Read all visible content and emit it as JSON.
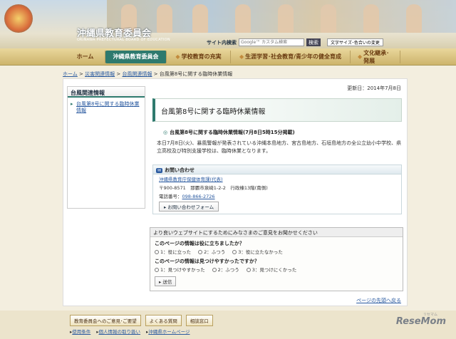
{
  "header": {
    "title": "沖縄県教育委員会",
    "subtitle": "OKINAWA PREFECTURAL BOARD OF EDUCATION",
    "search_label": "サイト内検索",
    "search_placeholder": "Google™ カスタム検索",
    "search_button": "検索",
    "style_button": "文字サイズ･色合いの変更"
  },
  "nav": {
    "items": [
      {
        "label": "ホーム"
      },
      {
        "label": "沖縄県教育委員会"
      },
      {
        "label": "学校教育の充実"
      },
      {
        "label": "生涯学習･社会教育/青少年の健全育成"
      },
      {
        "label": "文化継承･発展"
      }
    ]
  },
  "breadcrumb": {
    "home": "ホーム",
    "disaster": "災害関連情報",
    "typhoon": "台風関連情報",
    "current": "台風第8号に関する臨時休業情報",
    "sep": " > "
  },
  "sidebar": {
    "heading": "台風関連情報",
    "item": "台風第8号に関する臨時休業情報"
  },
  "main": {
    "updated": "更新日：2014年7月8日",
    "title": "台風第8号に関する臨時休業情報",
    "subheading": "台風第8号に関する臨時休業情報(7月8日5時15分掲載)",
    "body": "本日7月8日(火)、暴風警報が発表されている沖縄本島地方、宮古島地方、石垣島地方の全公立幼小中学校、県立高校及び特別支援学校は、臨時休業となります。"
  },
  "contact": {
    "heading": "お問い合わせ",
    "org": "沖縄県教育庁保健体育課(代表)",
    "address": "〒900-8571　那覇市泉崎1-2-2　行政棟13階(南側)",
    "phone_label": "電話番号：",
    "phone": "098-866-2726",
    "form_button": "お問い合わせフォーム"
  },
  "survey": {
    "heading": "より良いウェブサイトにするためにみなさまのご意見をお聞かせください",
    "q1": "このページの情報は役に立ちましたか？",
    "q1_options": [
      "1：役に立った",
      "2：ふつう",
      "3：役に立たなかった"
    ],
    "q2": "このページの情報は見つけやすかったですか？",
    "q2_options": [
      "1：見つけやすかった",
      "2：ふつう",
      "3：見つけにくかった"
    ],
    "send": "送信"
  },
  "page_top": "ページの先頭へ戻る",
  "footer": {
    "buttons": [
      "教育委員会へのご意見･ご要望",
      "よくある質問",
      "相談窓口"
    ],
    "links": [
      "使用条件",
      "個人情報の取り扱い",
      "沖縄県ホームページ"
    ]
  },
  "watermark": "ReseMom",
  "watermark_sub": "リセマム"
}
